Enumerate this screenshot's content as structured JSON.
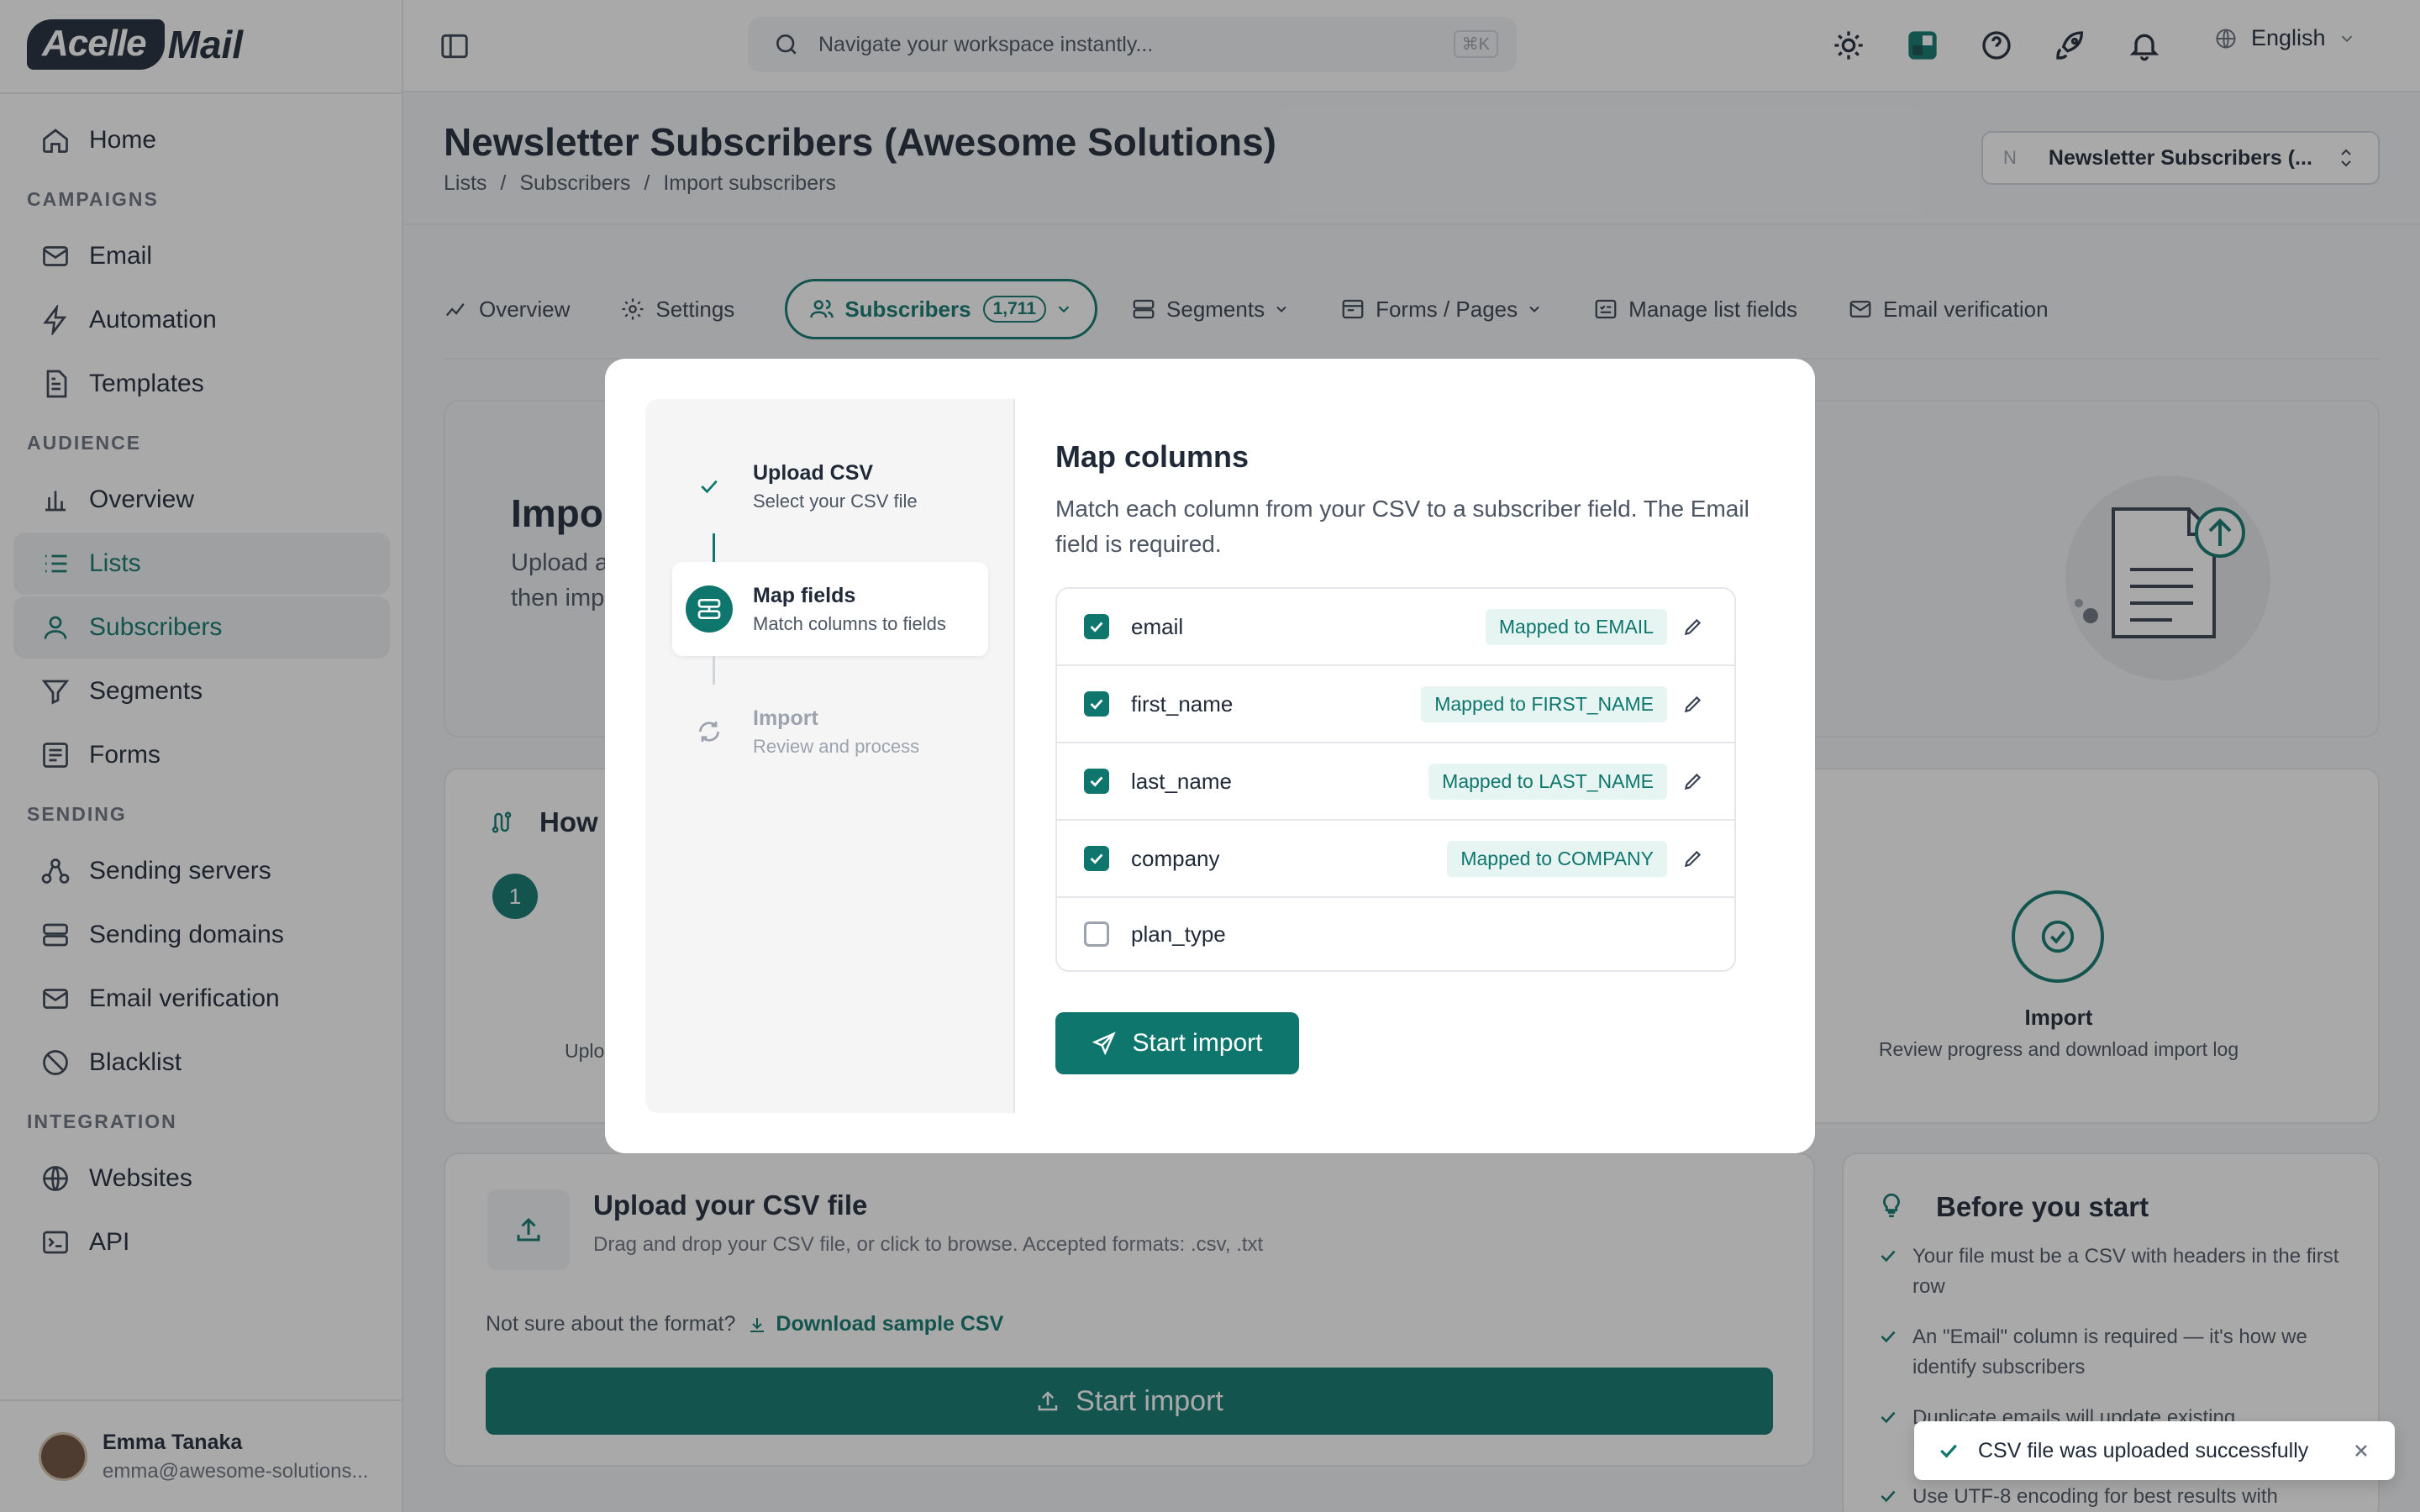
{
  "app": {
    "logo_badge": "Acelle",
    "logo_rest": "Mail"
  },
  "sidebar": {
    "items": [
      {
        "label": "Home",
        "icon": "home-icon"
      },
      {
        "section": "CAMPAIGNS"
      },
      {
        "label": "Email",
        "icon": "mail-icon"
      },
      {
        "label": "Automation",
        "icon": "bolt-icon"
      },
      {
        "label": "Templates",
        "icon": "document-icon"
      },
      {
        "section": "AUDIENCE"
      },
      {
        "label": "Overview",
        "icon": "bar-chart-icon"
      },
      {
        "label": "Lists",
        "icon": "list-icon",
        "active": true
      },
      {
        "label": "Subscribers",
        "icon": "user-icon",
        "active": true
      },
      {
        "label": "Segments",
        "icon": "filter-icon"
      },
      {
        "label": "Forms",
        "icon": "form-icon"
      },
      {
        "section": "SENDING"
      },
      {
        "label": "Sending servers",
        "icon": "network-icon"
      },
      {
        "label": "Sending domains",
        "icon": "server-icon"
      },
      {
        "label": "Email verification",
        "icon": "mail-check-icon"
      },
      {
        "label": "Blacklist",
        "icon": "ban-icon"
      },
      {
        "section": "INTEGRATION"
      },
      {
        "label": "Websites",
        "icon": "globe-icon"
      },
      {
        "label": "API",
        "icon": "terminal-icon"
      }
    ],
    "user": {
      "name": "Emma Tanaka",
      "email": "emma@awesome-solutions..."
    }
  },
  "topbar": {
    "search_placeholder": "Navigate your workspace instantly...",
    "shortcut": "⌘K",
    "language": "English"
  },
  "header": {
    "title": "Newsletter Subscribers (Awesome Solutions)",
    "breadcrumbs": [
      "Lists",
      "Subscribers",
      "Import subscribers"
    ],
    "list_selector": {
      "initial": "N",
      "label": "Newsletter Subscribers (..."
    }
  },
  "tabs": [
    {
      "label": "Overview"
    },
    {
      "label": "Settings"
    },
    {
      "label": "Subscribers",
      "count": "1,711",
      "active": true
    },
    {
      "label": "Segments"
    },
    {
      "label": "Forms / Pages"
    },
    {
      "label": "Manage list fields"
    },
    {
      "label": "Email verification"
    }
  ],
  "background": {
    "hero_title_partial": "Impor",
    "hero_text_partial_1": "Upload a",
    "hero_text_partial_2": "then imp",
    "how_title_partial": "How",
    "step1_num": "1",
    "step1_caption_partial": "Uplo",
    "import_step_title": "Import",
    "import_step_text": "Review progress and download import log",
    "upload_title": "Upload your CSV file",
    "upload_text": "Drag and drop your CSV file, or click to browse. Accepted formats: .csv, .txt",
    "format_question": "Not sure about the format?",
    "download_sample": "Download sample CSV",
    "start_import_big": "Start import",
    "before_title": "Before you start",
    "tips": [
      "Your file must be a CSV with headers in the first row",
      "An \"Email\" column is required — it's how we identify subscribers",
      "Duplicate emails will update existing",
      "Use UTF-8 encoding for best results with"
    ]
  },
  "modal": {
    "steps": [
      {
        "title": "Upload CSV",
        "subtitle": "Select your CSV file",
        "state": "done"
      },
      {
        "title": "Map fields",
        "subtitle": "Match columns to fields",
        "state": "current"
      },
      {
        "title": "Import",
        "subtitle": "Review and process",
        "state": "pending"
      }
    ],
    "title": "Map columns",
    "description": "Match each column from your CSV to a subscriber field. The Email field is required.",
    "fields": [
      {
        "name": "email",
        "checked": true,
        "mapped": "Mapped to EMAIL"
      },
      {
        "name": "first_name",
        "checked": true,
        "mapped": "Mapped to FIRST_NAME"
      },
      {
        "name": "last_name",
        "checked": true,
        "mapped": "Mapped to LAST_NAME"
      },
      {
        "name": "company",
        "checked": true,
        "mapped": "Mapped to COMPANY"
      },
      {
        "name": "plan_type",
        "checked": false,
        "mapped": ""
      }
    ],
    "start_button": "Start import"
  },
  "toast": {
    "message": "CSV file was uploaded successfully"
  },
  "colors": {
    "accent": "#0f766e",
    "overlay": "rgba(30,30,30,0.38)"
  }
}
